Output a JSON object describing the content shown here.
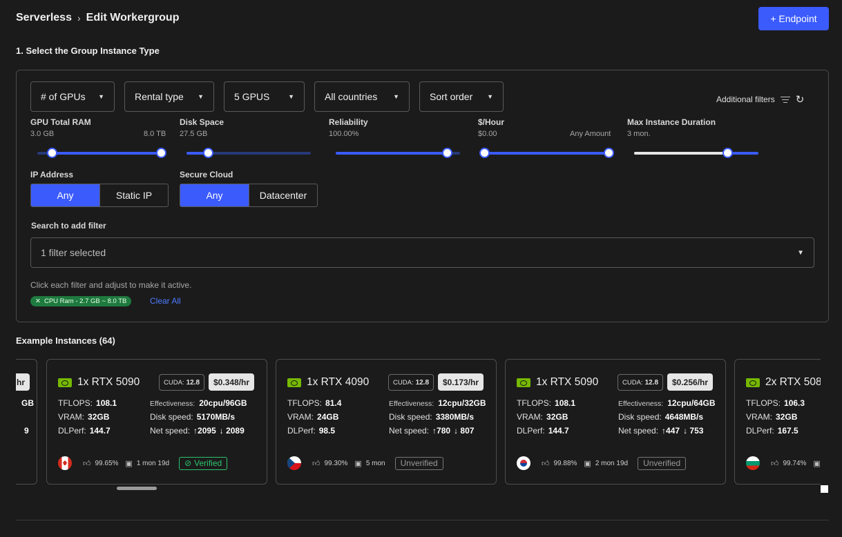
{
  "breadcrumb": {
    "root": "Serverless",
    "separator": "›",
    "current": "Edit Workergroup"
  },
  "endpoint_button": "+ Endpoint",
  "section_title": "1. Select the Group Instance Type",
  "dropdowns": [
    "# of GPUs",
    "Rental type",
    "5 GPUS",
    "All countries",
    "Sort order"
  ],
  "additional_filters": "Additional filters",
  "sliders": {
    "gpu_ram": {
      "label": "GPU Total RAM",
      "min": "3.0 GB",
      "max": "8.0 TB"
    },
    "disk": {
      "label": "Disk Space",
      "min": "27.5 GB"
    },
    "reliability": {
      "label": "Reliability",
      "min": "100.00%"
    },
    "price": {
      "label": "$/Hour",
      "min": "$0.00",
      "max": "Any Amount"
    },
    "duration": {
      "label": "Max Instance Duration",
      "min": "3 mon."
    }
  },
  "ip_address": {
    "label": "IP Address",
    "options": [
      "Any",
      "Static IP"
    ]
  },
  "secure_cloud": {
    "label": "Secure Cloud",
    "options": [
      "Any",
      "Datacenter"
    ]
  },
  "search": {
    "label": "Search to add filter",
    "value": "1 filter selected"
  },
  "hint": "Click each filter and adjust to make it active.",
  "chip": {
    "icon": "✕",
    "label": "CPU Ram - 2.7 GB ~ 8.0 TB"
  },
  "clear_all": "Clear All",
  "examples_title": "Example Instances (64)",
  "partial_card": {
    "price": "hr",
    "disk": "GB",
    "net": "9"
  },
  "cards": [
    {
      "gpu": "1x RTX 5090",
      "cuda_label": "CUDA:",
      "cuda": "12.8",
      "price": "$0.348/hr",
      "tflops_label": "TFLOPS:",
      "tflops": "108.1",
      "vram_label": "VRAM:",
      "vram": "32GB",
      "dlperf_label": "DLPerf:",
      "dlperf": "144.7",
      "eff_label": "Effectiveness:",
      "eff": "20cpu/96GB",
      "disk_label": "Disk speed:",
      "disk": "5170MB/s",
      "net_label": "Net speed:",
      "up": "↑2095",
      "down": "↓ 2089",
      "flag": "canada",
      "reliability": "99.65%",
      "duration": "1 mon 19d",
      "status": "Verified"
    },
    {
      "gpu": "1x RTX 4090",
      "cuda_label": "CUDA:",
      "cuda": "12.8",
      "price": "$0.173/hr",
      "tflops_label": "TFLOPS:",
      "tflops": "81.4",
      "vram_label": "VRAM:",
      "vram": "24GB",
      "dlperf_label": "DLPerf:",
      "dlperf": "98.5",
      "eff_label": "Effectiveness:",
      "eff": "12cpu/32GB",
      "disk_label": "Disk speed:",
      "disk": "3380MB/s",
      "net_label": "Net speed:",
      "up": "↑780",
      "down": "↓ 807",
      "flag": "czechia",
      "reliability": "99.30%",
      "duration": "5 mon",
      "status": "Unverified"
    },
    {
      "gpu": "1x RTX 5090",
      "cuda_label": "CUDA:",
      "cuda": "12.8",
      "price": "$0.256/hr",
      "tflops_label": "TFLOPS:",
      "tflops": "108.1",
      "vram_label": "VRAM:",
      "vram": "32GB",
      "dlperf_label": "DLPerf:",
      "dlperf": "144.7",
      "eff_label": "Effectiveness:",
      "eff": "12cpu/64GB",
      "disk_label": "Disk speed:",
      "disk": "4648MB/s",
      "net_label": "Net speed:",
      "up": "↑447",
      "down": "↓ 753",
      "flag": "south-korea",
      "reliability": "99.88%",
      "duration": "2 mon 19d",
      "status": "Unverified"
    },
    {
      "gpu": "2x RTX 508",
      "tflops_label": "TFLOPS:",
      "tflops": "106.3",
      "vram_label": "VRAM:",
      "vram": "32GB",
      "dlperf_label": "DLPerf:",
      "dlperf": "167.5",
      "flag": "bulgaria",
      "reliability": "99.74%"
    }
  ]
}
